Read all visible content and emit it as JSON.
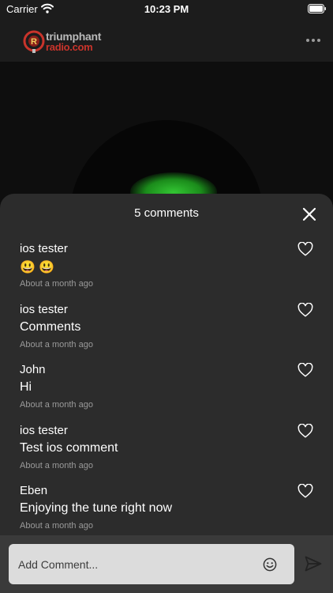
{
  "status_bar": {
    "carrier": "Carrier",
    "time": "10:23 PM"
  },
  "header": {
    "logo_line_1": "triumphant",
    "logo_line_2": "radio.com",
    "logo_emblem_letter": "R"
  },
  "comments_sheet": {
    "title": "5 comments",
    "comments": [
      {
        "author": "ios tester",
        "text": "😃 😃",
        "time": "About a month ago"
      },
      {
        "author": "ios tester",
        "text": "Comments",
        "time": "About a month ago"
      },
      {
        "author": "John",
        "text": "Hi",
        "time": "About a month ago"
      },
      {
        "author": "ios tester",
        "text": "Test ios comment",
        "time": "About a month ago"
      },
      {
        "author": "Eben",
        "text": "Enjoying the tune right now",
        "time": "About a month ago"
      }
    ]
  },
  "composer": {
    "placeholder": "Add Comment..."
  },
  "icons": {
    "wifi": "wifi-icon",
    "battery": "battery-icon",
    "more": "more-icon",
    "close": "close-icon",
    "like": "heart-icon",
    "emoji": "emoji-icon",
    "send": "send-icon"
  },
  "colors": {
    "sheet_background": "#2c2c2c",
    "header_background": "#1c1c1c",
    "logo_accent": "#c9342b",
    "artwork_glow": "#33c533",
    "input_background": "#dcdcdc"
  }
}
